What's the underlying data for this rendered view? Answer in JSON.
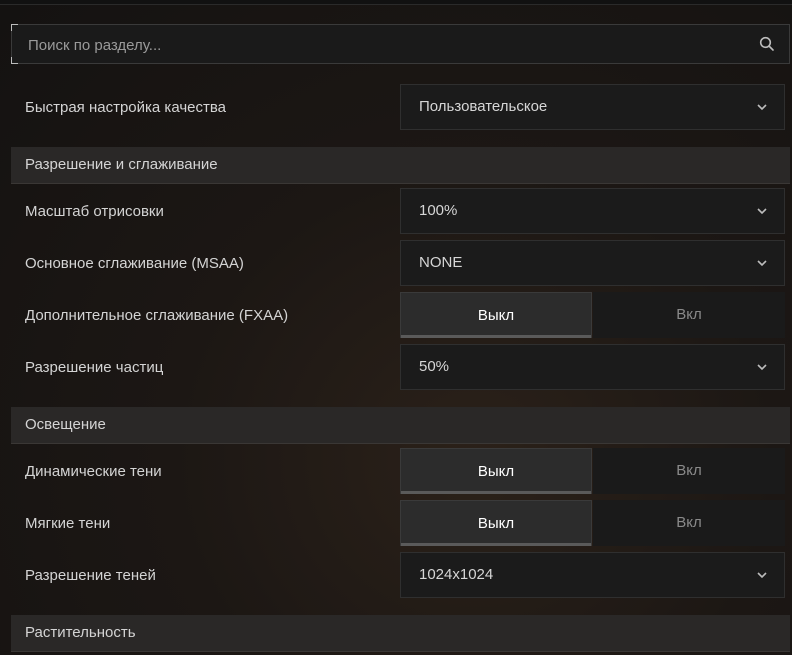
{
  "search": {
    "placeholder": "Поиск по разделу..."
  },
  "quality": {
    "label": "Быстрая настройка качества",
    "value": "Пользовательское"
  },
  "sections": {
    "resolution": "Разрешение и сглаживание",
    "lighting": "Освещение",
    "vegetation": "Растительность"
  },
  "render_scale": {
    "label": "Масштаб отрисовки",
    "value": "100%"
  },
  "msaa": {
    "label": "Основное сглаживание (MSAA)",
    "value": "NONE"
  },
  "fxaa": {
    "label": "Дополнительное сглаживание (FXAA)",
    "off": "Выкл",
    "on": "Вкл",
    "selected": "off"
  },
  "particles": {
    "label": "Разрешение частиц",
    "value": "50%"
  },
  "dynamic_shadows": {
    "label": "Динамические тени",
    "off": "Выкл",
    "on": "Вкл",
    "selected": "off"
  },
  "soft_shadows": {
    "label": "Мягкие тени",
    "off": "Выкл",
    "on": "Вкл",
    "selected": "off"
  },
  "shadow_res": {
    "label": "Разрешение теней",
    "value": "1024x1024"
  },
  "icons": {
    "search": "search-icon",
    "dropdown": "chevron-down-icon"
  }
}
